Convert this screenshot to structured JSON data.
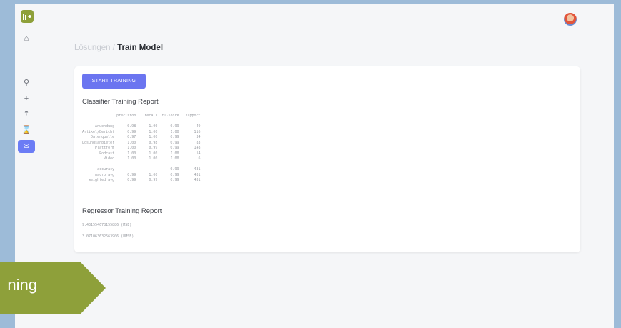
{
  "sidebar": {
    "logo_text": "",
    "icons": [
      "home-icon",
      "model-icon",
      "plus-icon",
      "upload-icon",
      "hourglass-icon",
      "chat-icon"
    ]
  },
  "breadcrumb": {
    "parent": "Lösungen",
    "separator": " / ",
    "current": "Train Model"
  },
  "card": {
    "start_button": "START TRAINING",
    "classifier_title": "Classifier Training Report",
    "report": {
      "header": [
        "",
        "precision",
        "recall",
        "f1-score",
        "support"
      ],
      "rows": [
        [
          "Anwendung",
          "0.98",
          "1.00",
          "0.99",
          "49"
        ],
        [
          "Artikel/Bericht",
          "0.99",
          "1.00",
          "1.00",
          "116"
        ],
        [
          "Datenquelle",
          "0.97",
          "1.00",
          "0.99",
          "34"
        ],
        [
          "Lösungsanbieter",
          "1.00",
          "0.98",
          "0.99",
          "83"
        ],
        [
          "Plattform",
          "1.00",
          "0.99",
          "0.99",
          "148"
        ],
        [
          "Podcast",
          "1.00",
          "1.00",
          "1.00",
          "14"
        ],
        [
          "Video",
          "1.00",
          "1.00",
          "1.00",
          "6"
        ]
      ],
      "summary": [
        [
          "accuracy",
          "",
          "",
          "0.99",
          "431"
        ],
        [
          "macro avg",
          "0.99",
          "1.00",
          "0.99",
          "431"
        ],
        [
          "weighted avg",
          "0.99",
          "0.99",
          "0.99",
          "431"
        ]
      ]
    },
    "regressor_title": "Regressor Training Report",
    "mse": "9.431554678155886 (MSE)",
    "rmse": "3.071063632563906 (RMSE)"
  },
  "overlay": {
    "label": "ning",
    "color": "#8ea03a"
  },
  "colors": {
    "accent": "#6b75f0",
    "brand": "#8ea03a",
    "background": "#9dbbd8"
  }
}
